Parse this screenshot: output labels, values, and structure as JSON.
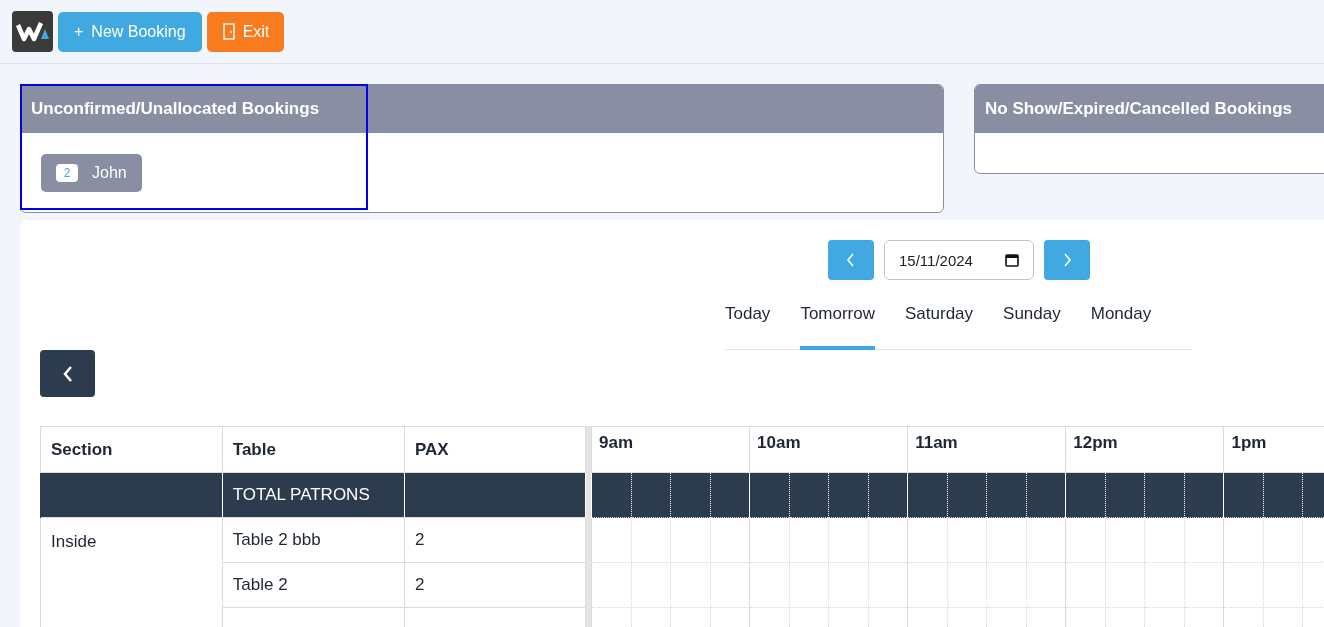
{
  "toolbar": {
    "buttons": [
      {
        "kind": "new",
        "icon": "+",
        "label": "New Booking"
      },
      {
        "kind": "exit",
        "label": "Exit"
      }
    ]
  },
  "panels": [
    {
      "title": "Unconfirmed/Unallocated Bookings",
      "highlighted": true,
      "bookings": [
        {
          "count": "2",
          "name": "John"
        }
      ]
    },
    {
      "title": "No Show/Expired/Cancelled Bookings",
      "highlighted": false
    }
  ],
  "date_picker": {
    "value": "15/11/2024"
  },
  "day_tabs": [
    {
      "label": "Today",
      "selected": false
    },
    {
      "label": "Tomorrow",
      "selected": true
    },
    {
      "label": "Saturday",
      "selected": false
    },
    {
      "label": "Sunday",
      "selected": false
    },
    {
      "label": "Monday",
      "selected": false
    }
  ],
  "table": {
    "columns": [
      "Section",
      "Table",
      "PAX"
    ],
    "hours": [
      "9am",
      "10am",
      "11am",
      "12pm",
      "1pm"
    ],
    "total_row": {
      "label": "TOTAL PATRONS"
    },
    "rows": [
      {
        "section": "Inside",
        "table": "Table 2 bbb",
        "pax": "2"
      },
      {
        "table": "Table 2",
        "pax": "2"
      }
    ]
  }
}
